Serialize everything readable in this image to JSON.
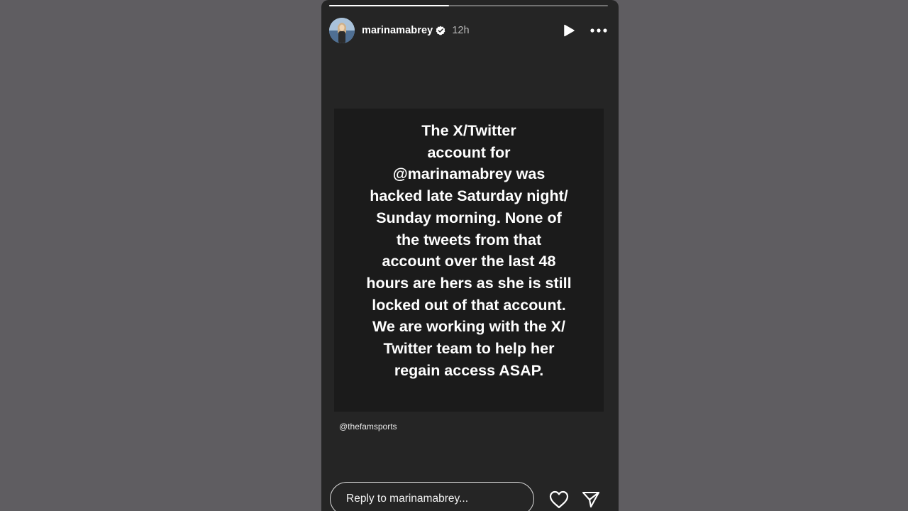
{
  "story": {
    "progress": 0.43,
    "username": "marinamabrey",
    "verified": true,
    "time": "12h",
    "message_lines": [
      "The X/Twitter",
      "account for",
      "@marinamabrey was",
      "hacked late Saturday night/",
      "Sunday morning. None of",
      "the tweets from that",
      "account over the last 48",
      "hours are hers as she is still",
      "locked out of that account.",
      "We are working with the X/",
      "Twitter team to help her",
      "regain access ASAP."
    ],
    "credit": "@thefamsports",
    "reply_placeholder": "Reply to marinamabrey..."
  },
  "icons": {
    "avatar": "avatar-photo",
    "verified": "verified-badge-icon",
    "play": "play-icon",
    "more": "more-dots-icon",
    "like": "heart-icon",
    "share": "send-icon"
  },
  "colors": {
    "backdrop": "#5f5d61",
    "story_bg": "#252525",
    "card_bg": "#1b1b1b",
    "text": "#ffffff",
    "muted": "#b9b9b9"
  }
}
